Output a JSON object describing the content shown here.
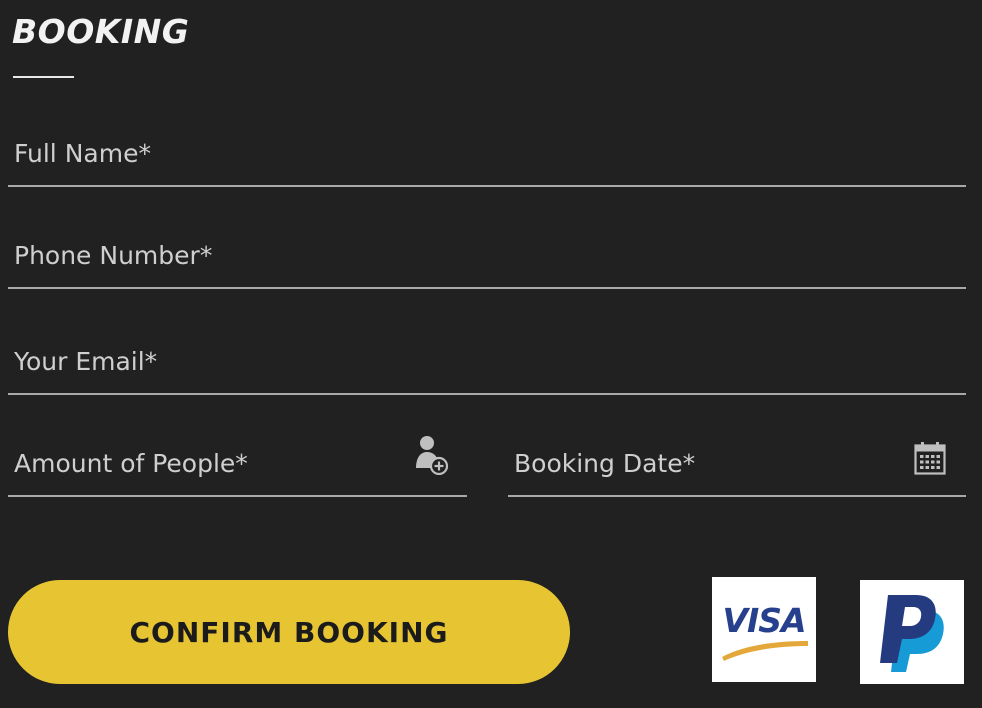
{
  "form": {
    "title": "BOOKING",
    "fields": {
      "full_name": {
        "placeholder": "Full Name*",
        "value": ""
      },
      "phone": {
        "placeholder": "Phone Number*",
        "value": ""
      },
      "email": {
        "placeholder": "Your Email*",
        "value": ""
      },
      "people": {
        "placeholder": "Amount of People*",
        "value": "",
        "icon": "add-person-icon"
      },
      "date": {
        "placeholder": "Booking Date*",
        "value": "",
        "icon": "calendar-icon"
      }
    },
    "confirm_label": "CONFIRM BOOKING"
  },
  "payment": {
    "visa_text": "VISA",
    "paypal_icon": "paypal-logo"
  },
  "colors": {
    "background": "#212121",
    "accent": "#e7c532",
    "text": "#d8d8d8",
    "underline": "#a9a9a9",
    "visa_blue": "#27408e",
    "visa_gold": "#e4a83a",
    "paypal_dark": "#253b80",
    "paypal_light": "#179bd7"
  }
}
